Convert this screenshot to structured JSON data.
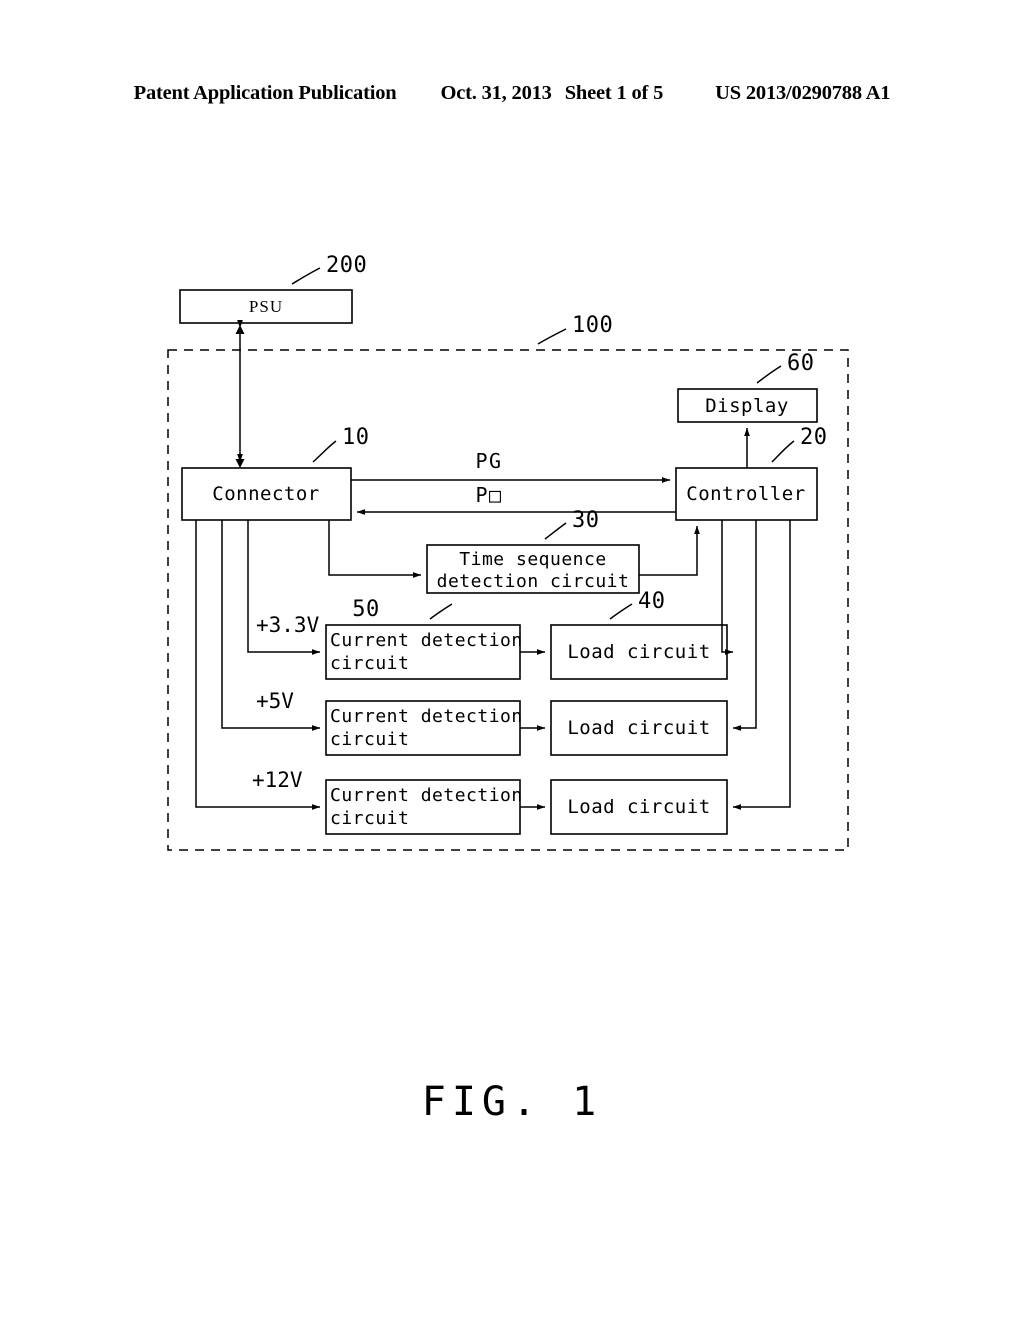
{
  "header": {
    "title": "Patent Application Publication",
    "date": "Oct. 31, 2013",
    "sheet": "Sheet 1 of 5",
    "publication_number": "US 2013/0290788 A1"
  },
  "figure": {
    "caption": "FIG. 1",
    "colors": {
      "ink": "#000000",
      "paper": "#ffffff"
    },
    "boundary": {
      "ref": "100"
    },
    "blocks": {
      "psu": {
        "label": "PSU",
        "ref": "200"
      },
      "connector": {
        "label": "Connector",
        "ref": "10"
      },
      "controller": {
        "label": "Controller",
        "ref": "20"
      },
      "display": {
        "label": "Display",
        "ref": "60"
      },
      "time_sequence": {
        "label_line1": "Time  sequence",
        "label_line2": "detection  circuit",
        "ref": "30"
      },
      "current_detect": {
        "label_line1": "Current  detection",
        "label_line2": "circuit",
        "ref": "50"
      },
      "load": {
        "label": "Load  circuit",
        "ref": "40"
      }
    },
    "signals": {
      "pg": "PG",
      "ps_on": "P□"
    },
    "rails": [
      {
        "label": "+3.3V"
      },
      {
        "label": "+5V"
      },
      {
        "label": "+12V"
      }
    ],
    "rows": [
      {
        "rail": "+3.3V",
        "current_detect_line1": "Current  detection",
        "current_detect_line2": "circuit",
        "load": "Load  circuit"
      },
      {
        "rail": "+5V",
        "current_detect_line1": "Current  detection",
        "current_detect_line2": "circuit",
        "load": "Load  circuit"
      },
      {
        "rail": "+12V",
        "current_detect_line1": "Current  detection",
        "current_detect_line2": "circuit",
        "load": "Load  circuit"
      }
    ]
  }
}
